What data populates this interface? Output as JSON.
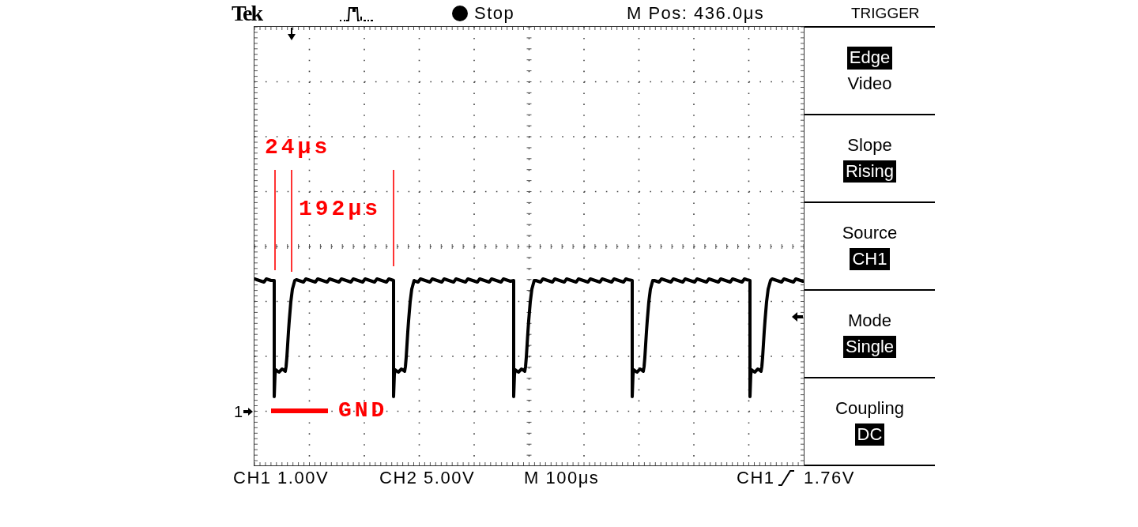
{
  "header": {
    "brand": "Tek",
    "run_state": "Stop",
    "position": "M Pos: 436.0μs"
  },
  "menu": {
    "title": "TRIGGER",
    "items": [
      {
        "kind": "options",
        "options": [
          {
            "label": "Edge",
            "selected": true
          },
          {
            "label": "Video",
            "selected": false
          }
        ]
      },
      {
        "kind": "setting",
        "label": "Slope",
        "value": "Rising"
      },
      {
        "kind": "setting",
        "label": "Source",
        "value": "CH1"
      },
      {
        "kind": "setting",
        "label": "Mode",
        "value": "Single"
      },
      {
        "kind": "setting",
        "label": "Coupling",
        "value": "DC"
      }
    ]
  },
  "display": {
    "channel_marker": "1",
    "annotations": {
      "pulse_width": "24μs",
      "period": "192μs",
      "ground": "GND"
    }
  },
  "status_bar": {
    "ch1_scale": "CH1 1.00V",
    "ch2_scale": "CH2 5.00V",
    "timebase": "M 100μs",
    "trigger_source": "CH1",
    "trigger_level": "1.76V"
  }
}
